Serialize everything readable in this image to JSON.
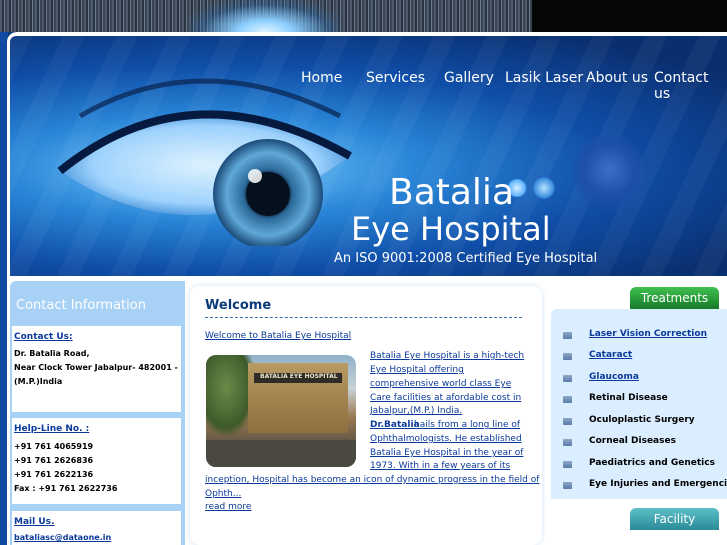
{
  "nav": {
    "items": [
      "Home",
      "Services",
      "Gallery",
      "Lasik Laser",
      "About us",
      "Contact us"
    ]
  },
  "hero": {
    "title_line1": "Batalia",
    "title_line2": "Eye Hospital",
    "subtitle": "An ISO 9001:2008 Certified Eye Hospital"
  },
  "contact": {
    "heading": "Contact Information",
    "address_label": "Contact Us:",
    "address_lines": [
      "Dr. Batalia Road,",
      "Near Clock Tower Jabalpur- 482001 -",
      "(M.P.)India"
    ],
    "helpline_label": "Help-Line No. :",
    "helpline_lines": [
      "+91 761 4065919",
      "+91 761 2626836",
      "+91 761 2622136",
      "Fax : +91 761 2622736"
    ],
    "mail_label": "Mail Us.",
    "mail_value": "bataliasc@dataone.in"
  },
  "welcome": {
    "title": "Welcome",
    "link": "Welcome to Batalia Eye Hospital",
    "photo_sign": "BATALIA EYE HOSPITAL",
    "para_lines": [
      "Batalia Eye Hospital is a high-tech",
      "Eye Hospital offering",
      "comprehensive world class Eye",
      "Care facilities at afordable cost in",
      "Jabalpur,(M.P.) India."
    ],
    "para2_bold": "Dr.Batalia",
    "para2_lines": [
      " hails from a long line of",
      "Ophthalmologists.  He established",
      "Batalia Eye Hospital in the year of",
      "1973. With in a few years of its"
    ],
    "para2_wide_lines": [
      "inception, Hospital has become an icon of dynamic progress in the field of",
      "Ophth..."
    ],
    "read_more": "read more"
  },
  "treatments": {
    "tab_label": "Treatments",
    "items": [
      {
        "label": "Laser Vision Correction",
        "link": true
      },
      {
        "label": "Cataract",
        "link": true
      },
      {
        "label": "Glaucoma",
        "link": true
      },
      {
        "label": "Retinal Disease",
        "link": false
      },
      {
        "label": "Oculoplastic Surgery",
        "link": false
      },
      {
        "label": "Corneal Diseases",
        "link": false
      },
      {
        "label": "Paediatrics and Genetics",
        "link": false
      },
      {
        "label": "Eye Injuries and Emergencies",
        "link": false
      }
    ]
  },
  "facility": {
    "tab_label": "Facility"
  }
}
